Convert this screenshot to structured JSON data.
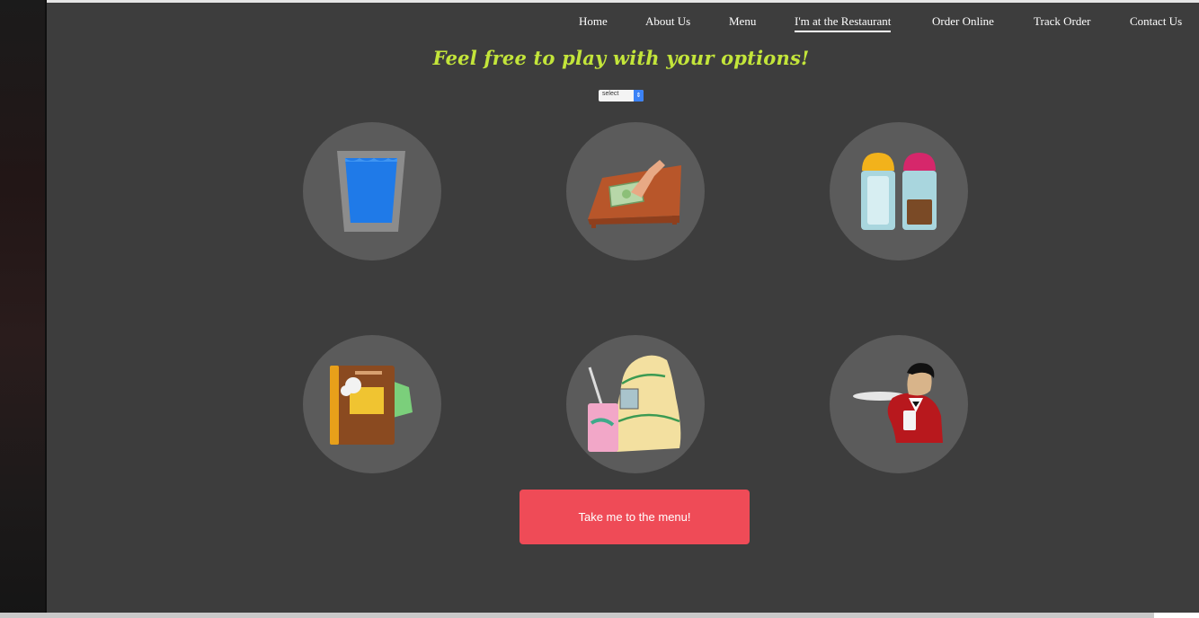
{
  "nav": {
    "items": [
      "Home",
      "About Us",
      "Menu",
      "I'm at the Restaurant",
      "Order Online",
      "Track Order",
      "Contact Us"
    ],
    "active_index": 3
  },
  "tagline": "Feel free to play with your options!",
  "selector": {
    "value": "select"
  },
  "options": {
    "items": [
      {
        "icon": "water-glass-icon"
      },
      {
        "icon": "pay-bill-icon"
      },
      {
        "icon": "salt-pepper-icon"
      },
      {
        "icon": "menu-book-icon"
      },
      {
        "icon": "takeout-bag-icon"
      },
      {
        "icon": "waiter-icon"
      }
    ]
  },
  "cta": {
    "label": "Take me to the menu!"
  },
  "colors": {
    "background": "#3d3d3d",
    "circle": "#5b5b5b",
    "tagline": "#c3e53a",
    "cta": "#ef4b57",
    "select_arrow": "#3b82f6"
  }
}
